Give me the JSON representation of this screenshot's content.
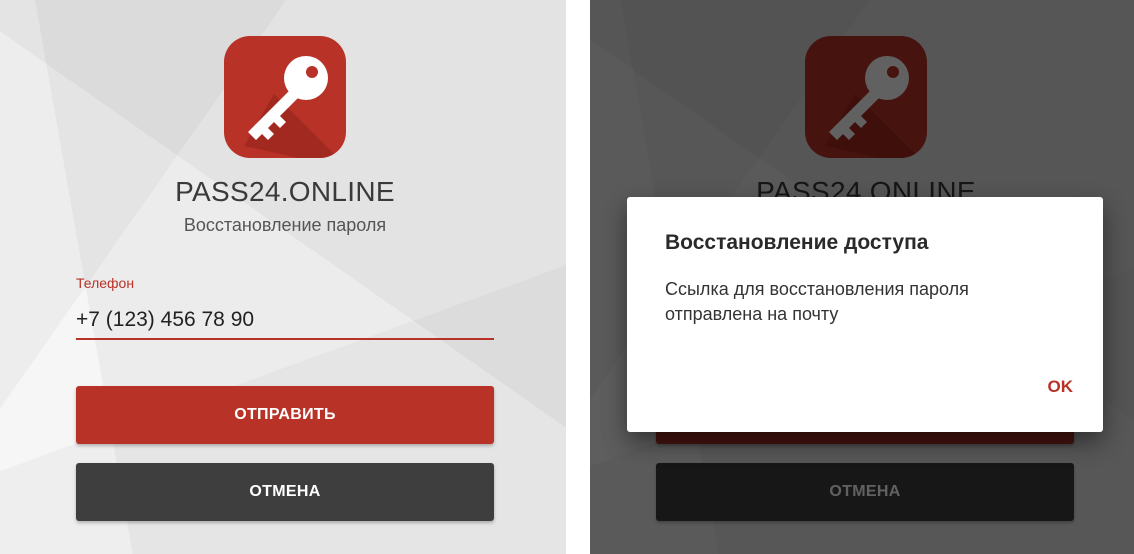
{
  "app": {
    "name": "PASS24.ONLINE",
    "subtitle": "Восстановление пароля",
    "brand_color": "#b83227"
  },
  "form": {
    "phone_label": "Телефон",
    "phone_value": "+7 (123) 456 78 90",
    "submit_label": "ОТПРАВИТЬ",
    "cancel_label": "ОТМЕНА"
  },
  "dialog": {
    "title": "Восстановление доступа",
    "message": "Ссылка для восстановления пароля отправлена на почту",
    "ok_label": "OK"
  },
  "icons": {
    "logo": "key-icon"
  }
}
